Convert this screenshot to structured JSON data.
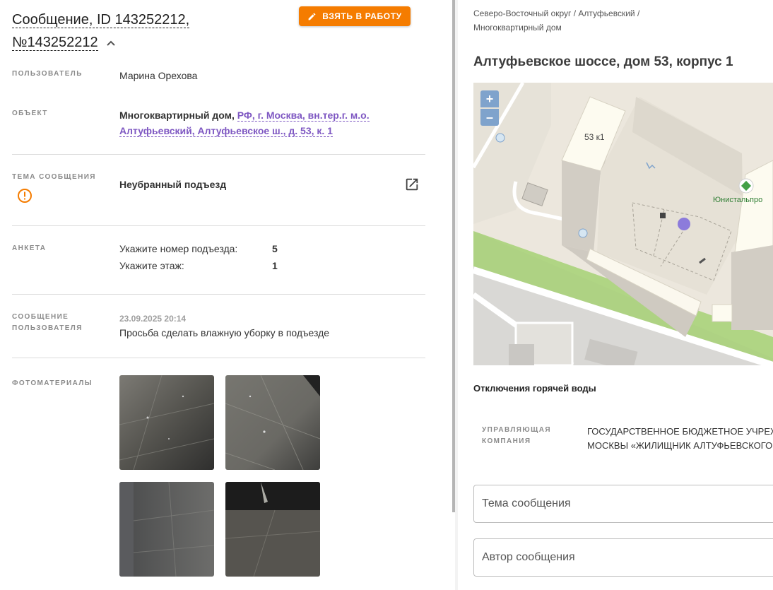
{
  "message": {
    "title_line1": "Сообщение, ID 143252212,",
    "title_line2": "№143252212",
    "take_button": "ВЗЯТЬ В РАБОТУ",
    "user_label": "ПОЛЬЗОВАТЕЛЬ",
    "user_value": "Марина Орехова",
    "object_label": "ОБЪЕКТ",
    "object_type": "Многоквартирный дом,",
    "object_link_line1": "РФ, г. Москва, вн.тер.г. м.о.",
    "object_link_line2": "Алтуфьевский, Алтуфьевское ш., д. 53, к. 1",
    "topic_label": "ТЕМА СООБЩЕНИЯ",
    "topic_value": "Неубранный подъезд",
    "survey_label": "АНКЕТА",
    "survey": [
      {
        "question": "Укажите номер подъезда:",
        "answer": "5"
      },
      {
        "question": "Укажите этаж:",
        "answer": "1"
      }
    ],
    "user_message_label_1": "СООБЩЕНИЕ",
    "user_message_label_2": "ПОЛЬЗОВАТЕЛЯ",
    "user_message_date": "23.09.2025 20:14",
    "user_message_text": "Просьба сделать влажную уборку в подъезде",
    "photos_label": "ФОТОМАТЕРИАЛЫ"
  },
  "right": {
    "breadcrumb_line1": "Северо-Восточный округ / Алтуфьевский /",
    "breadcrumb_line2": "Многоквартирный дом",
    "address": "Алтуфьевское шоссе, дом 53, корпус 1",
    "map": {
      "zoom_in": "+",
      "zoom_out": "–",
      "building_label": "53 к1",
      "poi_label": "Юнистальпро"
    },
    "hot_water": "Отключения горячей воды",
    "mc_label_1": "УПРАВЛЯЮЩАЯ",
    "mc_label_2": "КОМПАНИЯ",
    "mc_value_1": "ГОСУДАРСТВЕННОЕ БЮДЖЕТНОЕ УЧРЕЖ",
    "mc_value_2": "МОСКВЫ «ЖИЛИЩНИК АЛТУФЬЕВСКОГО",
    "field_topic_placeholder": "Тема сообщения",
    "field_author_placeholder": "Автор сообщения"
  },
  "colors": {
    "accent": "#f57c00",
    "link": "#7e57c2",
    "map_marker": "#8c7bdb",
    "poi": "#43a047"
  }
}
